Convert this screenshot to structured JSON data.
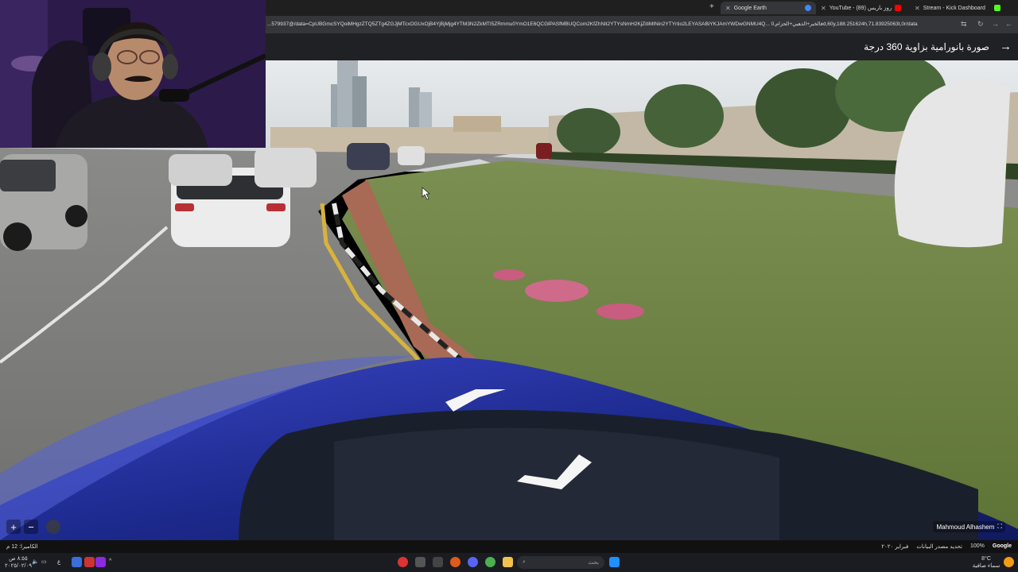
{
  "browser": {
    "tabs": [
      {
        "label": "Google Earth",
        "active": true,
        "color": "#4285f4"
      },
      {
        "label": "YouTube - روز باريس (89)",
        "active": false,
        "color": "#ff0000"
      },
      {
        "label": "Stream - Kick Dashboard",
        "active": false,
        "color": "#53fc18"
      }
    ],
    "new_tab": "+",
    "url": "...579937@/data=CpUBGmcSYQoiMHgzZTQ5ZTg4ZGJjMTcxOGUxOjB4YjBjMjg4YTM3N2ZkMTI5ZRmmu0YmO1E6QCGlPASfMBUQCom2KfZhNit2YTYsNmH2KjZitiMINin2YTYrtio2LEYASABiYKJAmYWDwGNMU4Q... فالخبر+الذهبي+الحزام,0d,60y,188.251624h,71.83925063t,0r/data"
  },
  "street_view": {
    "title": "صورة بانورامية بزاوية 360 درجة",
    "back_icon": "arrow-right-icon"
  },
  "map_controls": {
    "zoom_in": "+",
    "zoom_out": "−",
    "author": "Mahmoud Alhashem"
  },
  "status_bar": {
    "camera": "الكاميرا: 12 م",
    "date": "فبراير ٢٠٢٠",
    "data_source": "تحديد مصدر البيانات",
    "zoom": "100%",
    "logo": "Google"
  },
  "taskbar": {
    "search_placeholder": "بحث",
    "time": "٨:٥٥ ص",
    "date": "٢٠٢٥/٠٢/٠٩",
    "weather_temp": "8°C",
    "weather_desc": "سماء صافية",
    "lang": "ع"
  }
}
